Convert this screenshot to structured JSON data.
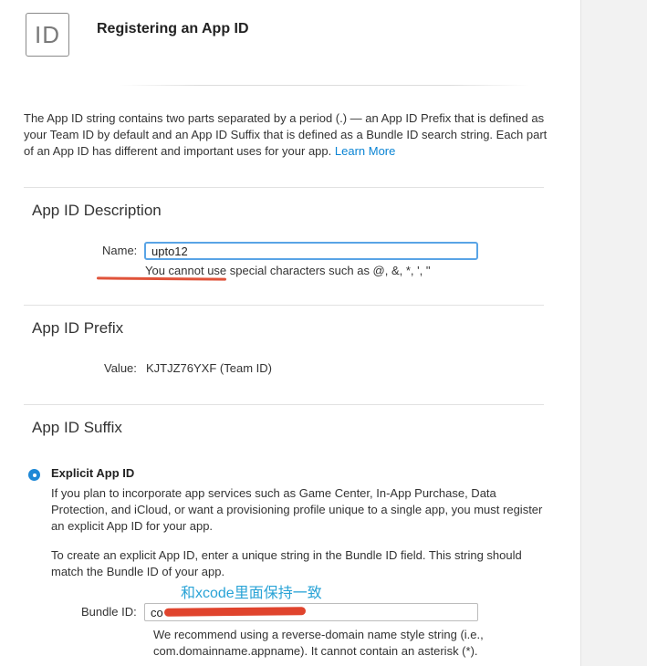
{
  "header": {
    "icon_text": "ID",
    "title": "Registering an App ID"
  },
  "intro": {
    "text": "The App ID string contains two parts separated by a period (.) — an App ID Prefix that is defined as your Team ID by default and an App ID Suffix that is defined as a Bundle ID search string. Each part of an App ID has different and important uses for your app.",
    "link": "Learn More"
  },
  "description_section": {
    "title": "App ID Description",
    "name_label": "Name:",
    "name_value": "upto12",
    "helper": "You cannot use special characters such as @, &, *, ', \""
  },
  "prefix_section": {
    "title": "App ID Prefix",
    "value_label": "Value:",
    "value": "KJTJZ76YXF (Team ID)"
  },
  "suffix_section": {
    "title": "App ID Suffix",
    "option_label": "Explicit App ID",
    "option_selected": true,
    "para1": "If you plan to incorporate app services such as Game Center, In-App Purchase, Data Protection, and iCloud, or want a provisioning profile unique to a single app, you must register an explicit App ID for your app.",
    "para2": "To create an explicit App ID, enter a unique string in the Bundle ID field. This string should match the Bundle ID of your app.",
    "annotation": "和xcode里面保持一致",
    "bundle_label": "Bundle ID:",
    "bundle_value": "co",
    "recommendation": "We recommend using a reverse-domain name style string (i.e., com.domainname.appname). It cannot contain an asterisk (*)."
  },
  "colors": {
    "link": "#0a84d4",
    "focus_border": "#59a4e6",
    "radio": "#1e88d6",
    "annotation_red": "#e0533a",
    "annotation_blue": "#29a3d6"
  }
}
